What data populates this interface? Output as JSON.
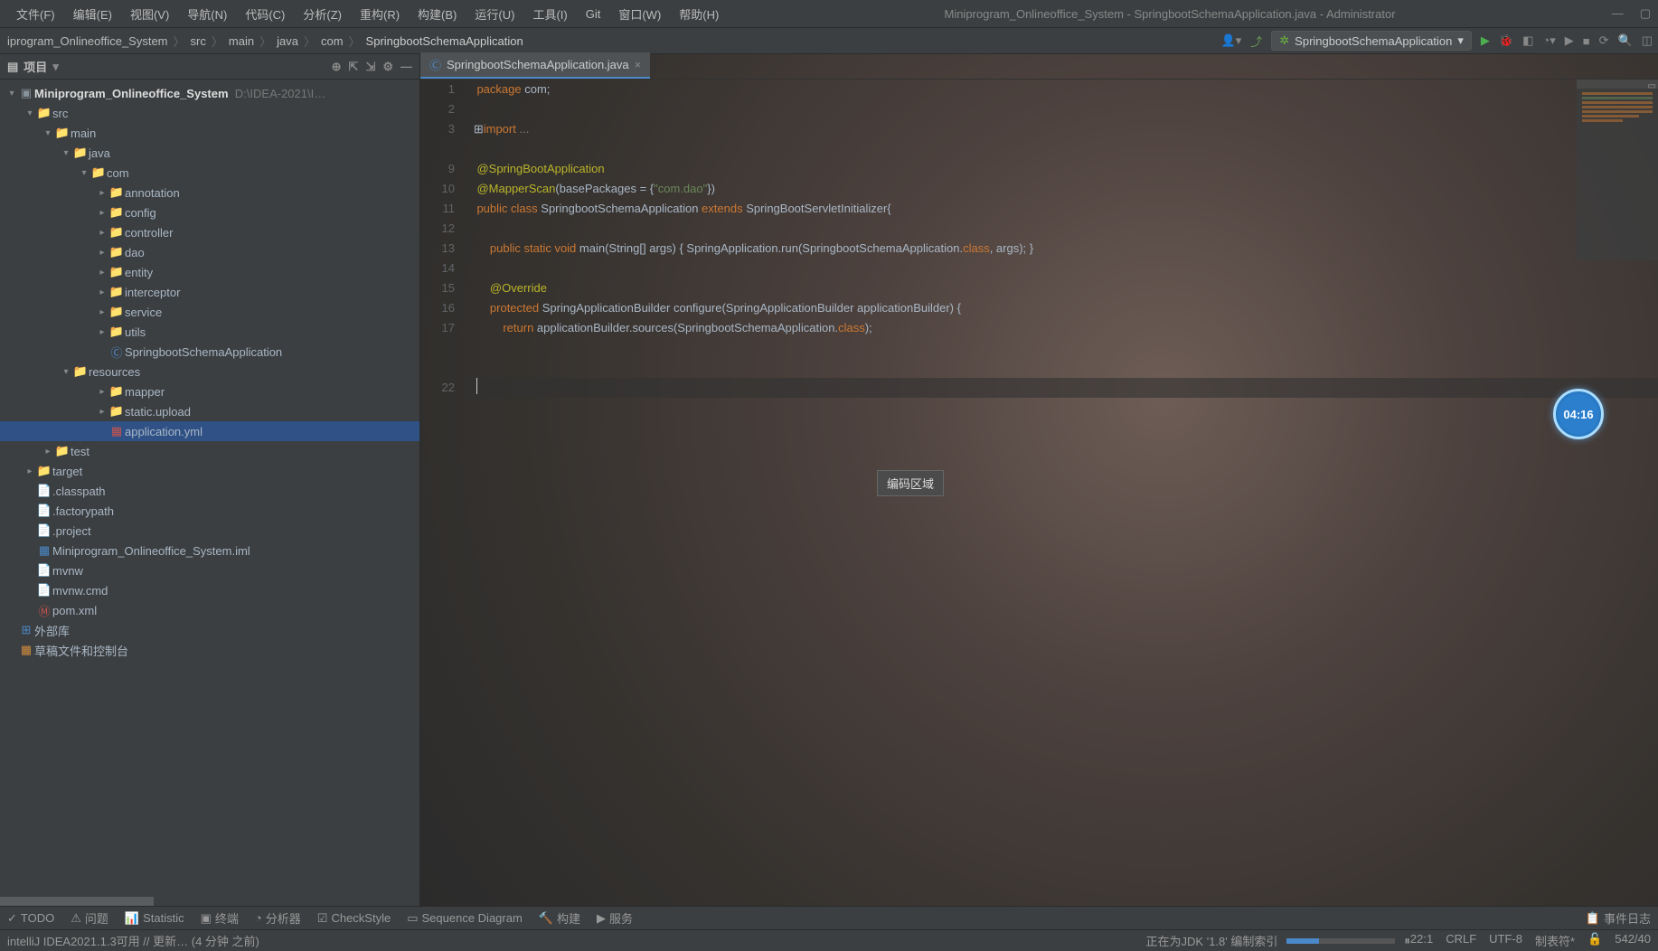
{
  "window": {
    "title": "Miniprogram_Onlineoffice_System - SpringbootSchemaApplication.java - Administrator"
  },
  "menu": {
    "file": "文件(F)",
    "edit": "编辑(E)",
    "view": "视图(V)",
    "nav": "导航(N)",
    "code": "代码(C)",
    "analyze": "分析(Z)",
    "refactor": "重构(R)",
    "build": "构建(B)",
    "run": "运行(U)",
    "tools": "工具(I)",
    "git": "Git",
    "window": "窗口(W)",
    "help": "帮助(H)"
  },
  "breadcrumb": {
    "items": [
      "iprogram_Onlineoffice_System",
      "src",
      "main",
      "java",
      "com",
      "SpringbootSchemaApplication"
    ]
  },
  "runconfig": {
    "name": "SpringbootSchemaApplication"
  },
  "sidebar": {
    "title": "项目",
    "tree": {
      "root": {
        "name": "Miniprogram_Onlineoffice_System",
        "path": "D:\\IDEA-2021\\I…"
      },
      "src": "src",
      "main": "main",
      "java": "java",
      "com": "com",
      "annotation": "annotation",
      "config": "config",
      "controller": "controller",
      "dao": "dao",
      "entity": "entity",
      "interceptor": "interceptor",
      "service": "service",
      "utils": "utils",
      "app_class": "SpringbootSchemaApplication",
      "resources": "resources",
      "mapper": "mapper",
      "static_upload": "static.upload",
      "app_yml": "application.yml",
      "test": "test",
      "target": "target",
      "classpath": ".classpath",
      "factorypath": ".factorypath",
      "project": ".project",
      "iml": "Miniprogram_Onlineoffice_System.iml",
      "mvnw": "mvnw",
      "mvnw_cmd": "mvnw.cmd",
      "pom": "pom.xml",
      "ext_libs": "外部库",
      "scratches": "草稿文件和控制台"
    }
  },
  "tab": {
    "name": "SpringbootSchemaApplication.java"
  },
  "code": {
    "l1": "package com;",
    "l3": "import ...",
    "l9": "@SpringBootApplication",
    "l10a": "@MapperScan(basePackages = {",
    "l10b": "\"com.dao\"",
    "l10c": "})",
    "l11a": "public class ",
    "l11b": "SpringbootSchemaApplication ",
    "l11c": "extends ",
    "l11d": "SpringBootServletInitializer{",
    "l13a": "    public static void ",
    "l13b": "main(String[] args) { SpringApplication.run(SpringbootSchemaApplication.",
    "l13c": "class",
    "l13d": ", args); }",
    "l15": "    @Override",
    "l16a": "    protected ",
    "l16b": "SpringApplicationBuilder configure(SpringApplicationBuilder applicationBuilder) {",
    "l17a": "        return ",
    "l17b": "applicationBuilder.sources(SpringbootSchemaApplication.",
    "l17c": "class",
    "l17d": ");"
  },
  "gutter_lines": [
    "1",
    "2",
    "3",
    "",
    "9",
    "10",
    "11",
    "12",
    "13",
    "14",
    "15",
    "16",
    "17",
    "",
    "",
    "22"
  ],
  "tooltip": {
    "text": "编码区域"
  },
  "timer": {
    "value": "04:16"
  },
  "bottom_tools": {
    "todo": "TODO",
    "problems": "问题",
    "statistic": "Statistic",
    "terminal": "终端",
    "profiler": "分析器",
    "checkstyle": "CheckStyle",
    "seqdiag": "Sequence Diagram",
    "build": "构建",
    "services": "服务",
    "eventlog": "事件日志"
  },
  "statusbar": {
    "left": "intelliJ IDEA2021.1.3可用 // 更新… (4 分钟 之前)",
    "indexing": "正在为JDK '1.8' 编制索引",
    "pos": "22:1",
    "lineend": "CRLF",
    "encoding": "UTF-8",
    "tab": "制表符*",
    "mem": "542/40"
  }
}
